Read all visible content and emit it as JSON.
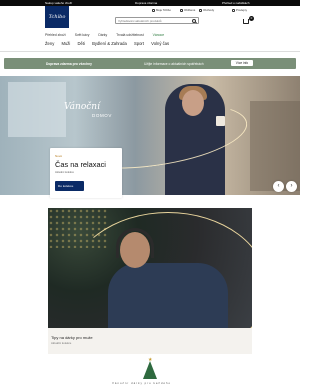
{
  "topbar": {
    "left": "Nakup vašeho zboží",
    "center": "Doprava zdarma",
    "right": "Přehled o nabídkách"
  },
  "header": {
    "logo_text": "Tchibo",
    "utilities": [
      "Moje Tchibo",
      "Oblíbené",
      "Obchody",
      "Prodejny"
    ],
    "search_placeholder": "Vyhledávání aktuálních produktů",
    "cart_count": "0"
  },
  "nav": {
    "primary": [
      "Přehled zboží",
      "Svět kávy",
      "Dárky",
      "Trvalá udržitelnost",
      "Vánoce"
    ],
    "categories": [
      "Ženy",
      "Muži",
      "Děti",
      "Bydlení & Zahrada",
      "Sport",
      "Volný čas"
    ]
  },
  "promo": {
    "text1": "Doprava zdarma pro všechny",
    "text2": "Užijte informace o aktuálních spotřebách",
    "button": "Více info"
  },
  "hero": {
    "script_title": "Vánoční",
    "script_sub": "DOMOV",
    "card_eyebrow": "Nové",
    "card_title": "Čas na relaxaci",
    "card_sub": "Aktuální kolekce",
    "card_button": "Do kolekce",
    "prev": "‹",
    "next": "›"
  },
  "feature": {
    "title": "Tipy na dárky pro muže",
    "sub": "Aktuální kolekce"
  },
  "bottom": {
    "tagline": "Vánoční dárky pro každého"
  },
  "colors": {
    "brand_navy": "#0a2a66",
    "promo_green": "#7a8f78",
    "tree_green": "#2e6a3f"
  }
}
